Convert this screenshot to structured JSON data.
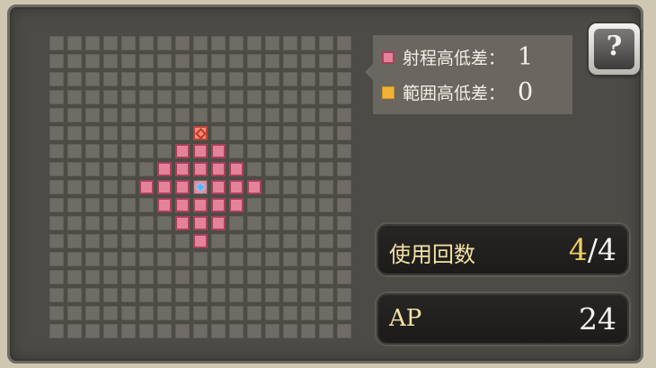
{
  "legend": {
    "shooting_height": {
      "label": "射程高低差：",
      "value": "1",
      "color": "#e3839a"
    },
    "area_height": {
      "label": "範囲高低差：",
      "value": "0",
      "color": "#f0b23a"
    }
  },
  "help_button": {
    "icon": "question-book-icon",
    "glyph": "?"
  },
  "uses": {
    "label": "使用回数",
    "current": "4",
    "separator": "/",
    "max": "4"
  },
  "ap": {
    "label": "AP",
    "value": "24"
  },
  "grid": {
    "size": 17,
    "center": [
      8,
      8
    ],
    "target": [
      8,
      5
    ],
    "range_cells": [
      [
        8,
        5
      ],
      [
        7,
        6
      ],
      [
        8,
        6
      ],
      [
        9,
        6
      ],
      [
        6,
        7
      ],
      [
        7,
        7
      ],
      [
        8,
        7
      ],
      [
        9,
        7
      ],
      [
        10,
        7
      ],
      [
        5,
        8
      ],
      [
        6,
        8
      ],
      [
        7,
        8
      ],
      [
        8,
        8
      ],
      [
        9,
        8
      ],
      [
        10,
        8
      ],
      [
        11,
        8
      ],
      [
        6,
        9
      ],
      [
        7,
        9
      ],
      [
        8,
        9
      ],
      [
        9,
        9
      ],
      [
        10,
        9
      ],
      [
        7,
        10
      ],
      [
        8,
        10
      ],
      [
        9,
        10
      ],
      [
        8,
        11
      ]
    ]
  }
}
